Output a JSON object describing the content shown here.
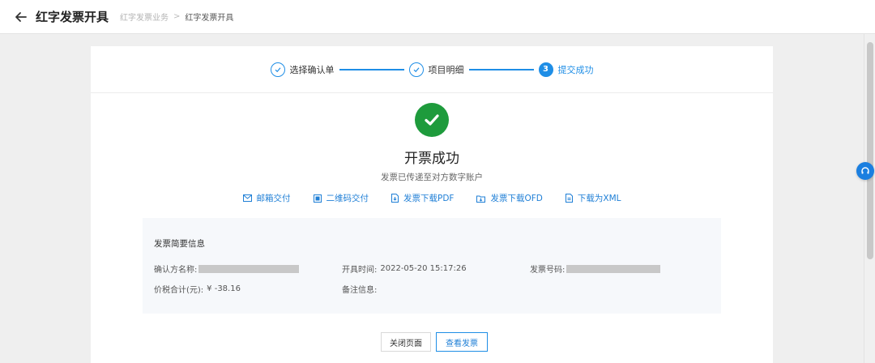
{
  "header": {
    "title": "红字发票开具",
    "breadcrumb": [
      "红字发票业务",
      "红字发票开具"
    ],
    "breadcrumb_sep": ">"
  },
  "steps": [
    {
      "label": "选择确认单",
      "state": "done"
    },
    {
      "label": "项目明细",
      "state": "done"
    },
    {
      "label": "提交成功",
      "state": "active",
      "number": "3"
    }
  ],
  "result": {
    "title": "开票成功",
    "subtitle": "发票已传递至对方数字账户"
  },
  "actions": [
    {
      "label": "邮箱交付",
      "icon": "mail-icon"
    },
    {
      "label": "二维码交付",
      "icon": "qrcode-icon"
    },
    {
      "label": "发票下载PDF",
      "icon": "download-pdf-icon"
    },
    {
      "label": "发票下载OFD",
      "icon": "download-ofd-icon"
    },
    {
      "label": "下载为XML",
      "icon": "download-xml-icon"
    }
  ],
  "summary": {
    "title": "发票简要信息",
    "buyer_label": "确认方名称:",
    "time_label": "开具时间:",
    "time_value": "2022-05-20 15:17:26",
    "number_label": "发票号码:",
    "total_label": "价税合计(元):",
    "total_value": "¥ -38.16",
    "remark_label": "备注信息:"
  },
  "buttons": {
    "close": "关闭页面",
    "view": "查看发票"
  },
  "colors": {
    "accent": "#1f8ee6",
    "success": "#1e9b3c"
  }
}
